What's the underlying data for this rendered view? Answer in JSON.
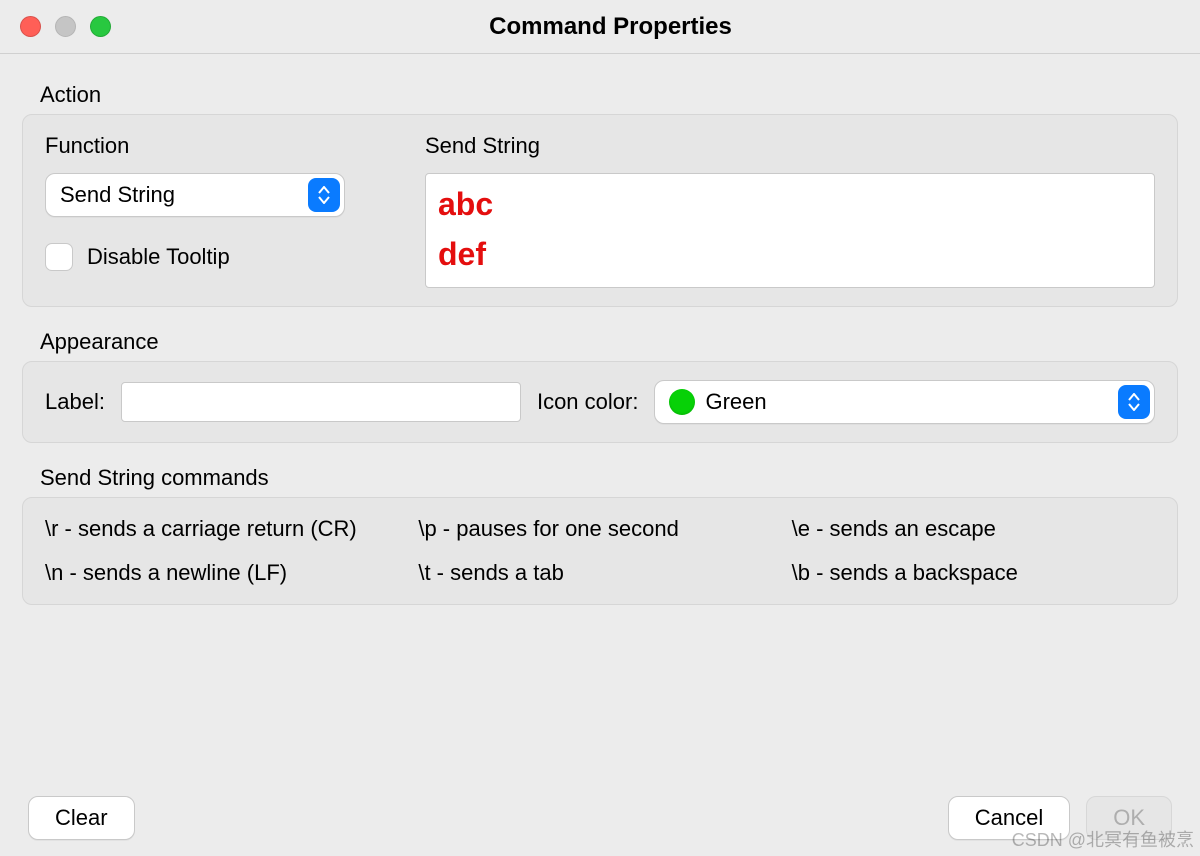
{
  "title": "Command Properties",
  "action": {
    "group_label": "Action",
    "function_label": "Function",
    "function_value": "Send String",
    "send_string_label": "Send String",
    "send_string_value": "abc\ndef",
    "disable_tooltip_label": "Disable Tooltip",
    "disable_tooltip_checked": false
  },
  "appearance": {
    "group_label": "Appearance",
    "label_label": "Label:",
    "label_value": "",
    "icon_color_label": "Icon color:",
    "icon_color_value": "Green",
    "icon_color_hex": "#07d107"
  },
  "commands": {
    "group_label": "Send String commands",
    "items": [
      "\\r - sends a carriage return (CR)",
      "\\p - pauses for one second",
      "\\e - sends an escape",
      "\\n - sends a newline (LF)",
      "\\t - sends a tab",
      "\\b - sends a backspace"
    ]
  },
  "footer": {
    "clear": "Clear",
    "cancel": "Cancel",
    "ok": "OK"
  },
  "watermark": "CSDN @北冥有鱼被烹"
}
